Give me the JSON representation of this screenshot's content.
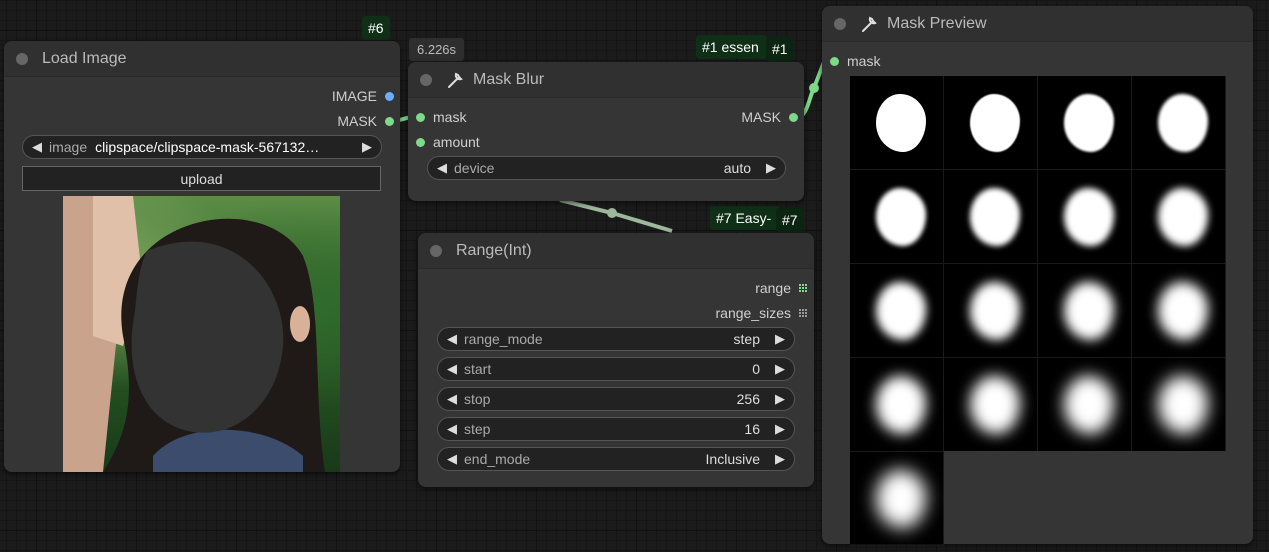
{
  "colors": {
    "badge_bg": "#0f3017",
    "node_bg": "#353535",
    "link_green": "#7ed98a",
    "image_slot_blue": "#6aaeff"
  },
  "badges": {
    "load_image_id": "#6",
    "mask_blur_timer": "6.226s",
    "essentials_tag": "#1 essen",
    "mask_blur_id": "#1",
    "easy_tag": "#7 Easy-",
    "range_id": "#7"
  },
  "load_image": {
    "title": "Load Image",
    "outputs": [
      "IMAGE",
      "MASK"
    ],
    "image_widget_label": "image",
    "image_widget_value": "clipspace/clipspace-mask-567132…",
    "upload_label": "upload"
  },
  "mask_blur": {
    "title": "Mask Blur",
    "inputs": [
      "mask",
      "amount"
    ],
    "output": "MASK",
    "device_label": "device",
    "device_value": "auto"
  },
  "range_int": {
    "title": "Range(Int)",
    "outputs": [
      "range",
      "range_sizes"
    ],
    "widgets": [
      {
        "label": "range_mode",
        "value": "step"
      },
      {
        "label": "start",
        "value": "0"
      },
      {
        "label": "stop",
        "value": "256"
      },
      {
        "label": "step",
        "value": "16"
      },
      {
        "label": "end_mode",
        "value": "Inclusive"
      }
    ]
  },
  "mask_preview": {
    "title": "Mask Preview",
    "input": "mask",
    "preview_count": 17
  }
}
